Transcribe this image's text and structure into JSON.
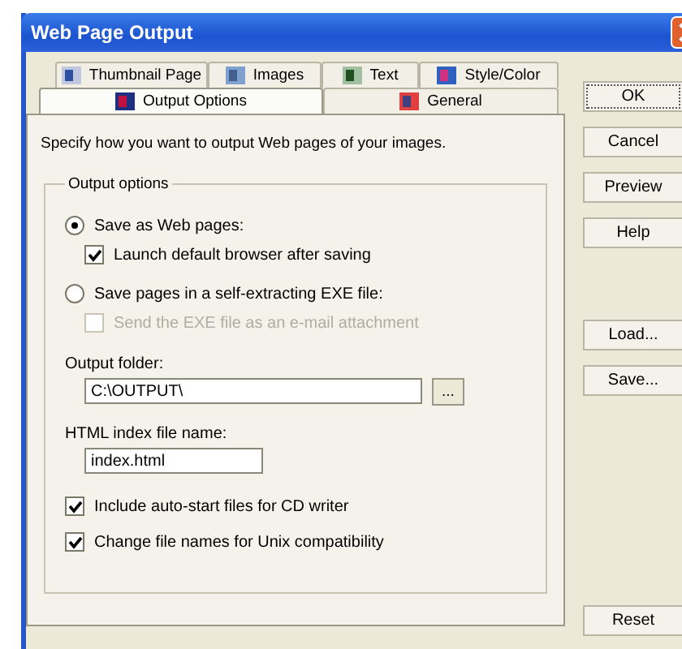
{
  "window": {
    "title": "Web Page Output"
  },
  "tabs": [
    [
      {
        "label": "Thumbnail Page",
        "selected": false
      },
      {
        "label": "Images",
        "selected": false
      },
      {
        "label": "Text",
        "selected": false
      },
      {
        "label": "Style/Color",
        "selected": false
      }
    ],
    [
      {
        "label": "Output Options",
        "selected": true
      },
      {
        "label": "General",
        "selected": false
      }
    ]
  ],
  "description": "Specify how you want to output Web pages of your images.",
  "output_options": {
    "title": "Output options",
    "choices": [
      {
        "label": "Save as Web pages:",
        "selected": true,
        "options": [
          {
            "label": "Launch default browser after saving",
            "checked": true,
            "disabled": false
          }
        ]
      },
      {
        "label": "Save pages in a self-extracting EXE file:",
        "selected": false,
        "options": [
          {
            "label": "Send the EXE file as an e-mail attachment",
            "checked": false,
            "disabled": true
          }
        ]
      }
    ],
    "output_folder": {
      "label": "Output folder:",
      "value": "C:\\OUTPUT\\",
      "browse": "..."
    },
    "index_file": {
      "label": "HTML index file name:",
      "value": "index.html"
    },
    "checkboxes": [
      {
        "label": "Include auto-start files for CD writer",
        "checked": true,
        "disabled": false
      },
      {
        "label": "Change file names for Unix compatibility",
        "checked": true,
        "disabled": false
      }
    ]
  },
  "buttons": [
    [
      {
        "label": "OK",
        "focused": true
      },
      {
        "label": "Cancel",
        "focused": false
      },
      {
        "label": "Preview",
        "focused": false
      },
      {
        "label": "Help",
        "focused": false
      }
    ],
    [
      {
        "label": "Load...",
        "focused": false
      },
      {
        "label": "Save...",
        "focused": false
      }
    ],
    [
      {
        "label": "Reset",
        "focused": false
      }
    ]
  ]
}
